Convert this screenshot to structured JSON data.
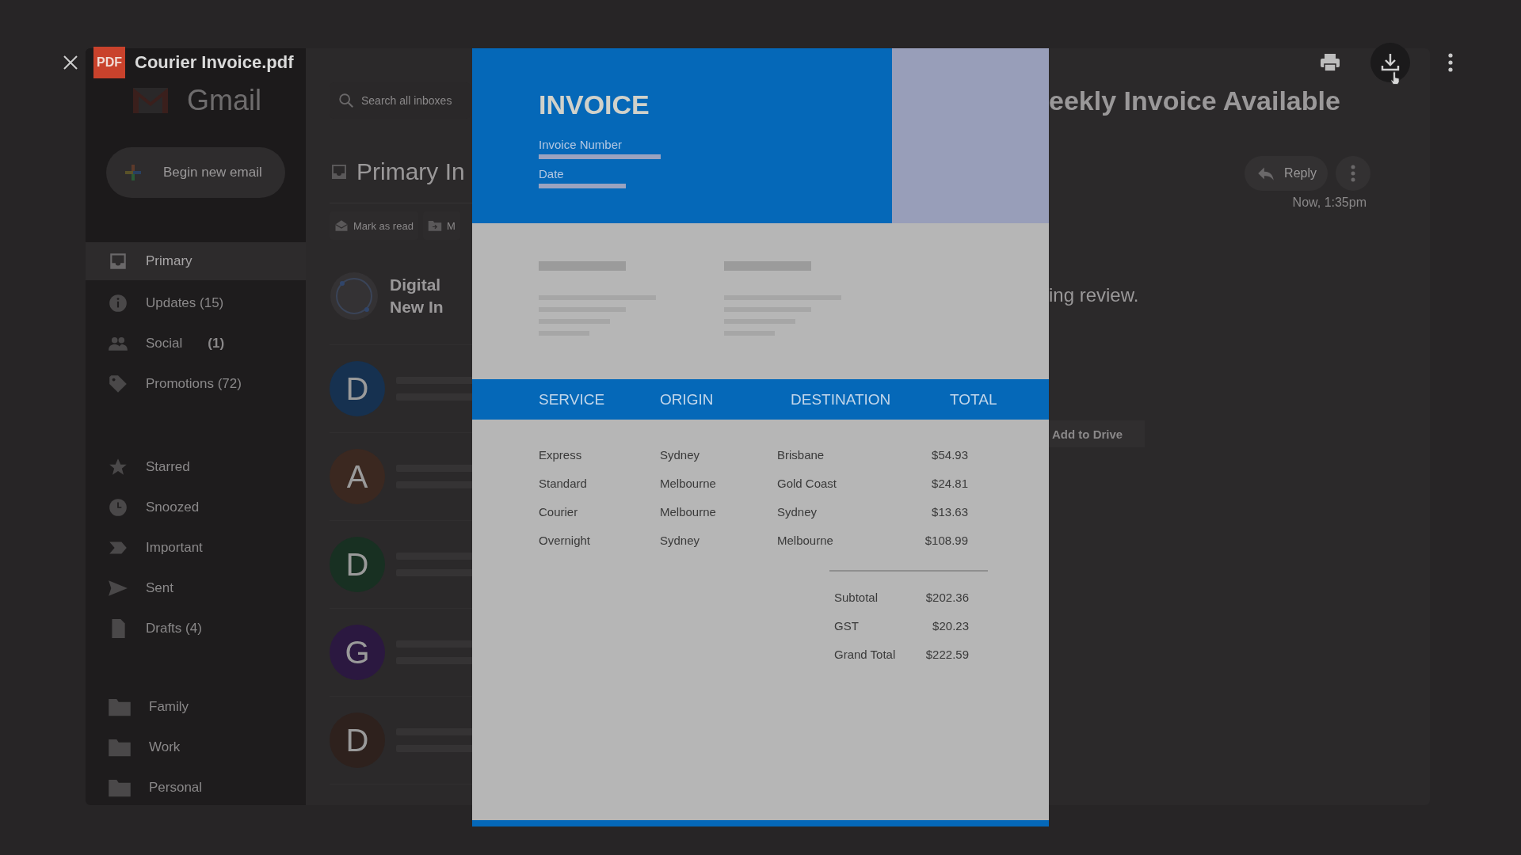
{
  "viewer": {
    "file_type": "PDF",
    "file_name": "Courier Invoice.pdf",
    "actions": [
      {
        "kind": "print",
        "hovered": false
      },
      {
        "kind": "download",
        "hovered": true
      },
      {
        "kind": "more",
        "hovered": false
      }
    ]
  },
  "gmail": {
    "logo": "Gmail",
    "compose": "Begin new email"
  },
  "sidebar": {
    "groups": [
      {
        "items": [
          {
            "label": "Primary",
            "selected": true
          },
          {
            "label": "Updates (15)",
            "selected": false
          },
          {
            "label": "Social",
            "count": "(1)",
            "selected": false
          },
          {
            "label": "Promotions (72)",
            "selected": false
          }
        ]
      },
      {
        "items": [
          {
            "label": "Starred",
            "selected": false
          },
          {
            "label": "Snoozed",
            "selected": false
          },
          {
            "label": "Important",
            "selected": false
          },
          {
            "label": "Sent",
            "selected": false
          },
          {
            "label": "Drafts (4)",
            "selected": false
          }
        ]
      },
      {
        "items": [
          {
            "label": "Family",
            "selected": false
          },
          {
            "label": "Work",
            "selected": false
          },
          {
            "label": "Personal",
            "selected": false
          }
        ]
      }
    ]
  },
  "mail_list": {
    "search": {
      "placeholder": "Search all inboxes"
    },
    "heading": "Primary In",
    "toolbar": [
      {
        "kind": "read",
        "label": "Mark as read"
      },
      {
        "kind": "move",
        "label": "M"
      }
    ],
    "emails": [
      {
        "kind": "logo",
        "lines": [
          "Digital",
          "New In"
        ]
      },
      {
        "kind": "avatar",
        "initial": "D",
        "color": "#163150"
      },
      {
        "kind": "avatar",
        "initial": "A",
        "color": "#3b2820"
      },
      {
        "kind": "avatar",
        "initial": "D",
        "color": "#183022"
      },
      {
        "kind": "avatar",
        "initial": "G",
        "color": "#2b1840"
      },
      {
        "kind": "avatar",
        "initial": "D",
        "color": "#2e211d"
      }
    ]
  },
  "invoice": {
    "title": "INVOICE",
    "fields": [
      "Invoice Number",
      "Date"
    ],
    "columns": [
      "SERVICE",
      "ORIGIN",
      "DESTINATION",
      "TOTAL"
    ],
    "rows": [
      [
        "Express",
        "Sydney",
        "Brisbane",
        "$54.93"
      ],
      [
        "Standard",
        "Melbourne",
        "Gold Coast",
        "$24.81"
      ],
      [
        "Courier",
        "Melbourne",
        "Sydney",
        "$13.63"
      ],
      [
        "Overnight",
        "Sydney",
        "Melbourne",
        "$108.99"
      ]
    ],
    "totals": [
      {
        "label": "Subtotal",
        "value": "$202.36"
      },
      {
        "label": "GST",
        "value": "$20.23"
      },
      {
        "label": "Grand Total",
        "value": "$222.59"
      }
    ]
  },
  "message": {
    "subject": "eekly Invoice Available",
    "reply": "Reply",
    "time": "Now, 1:35pm",
    "body": "ing review.",
    "attachment_action": "Add to Drive"
  }
}
